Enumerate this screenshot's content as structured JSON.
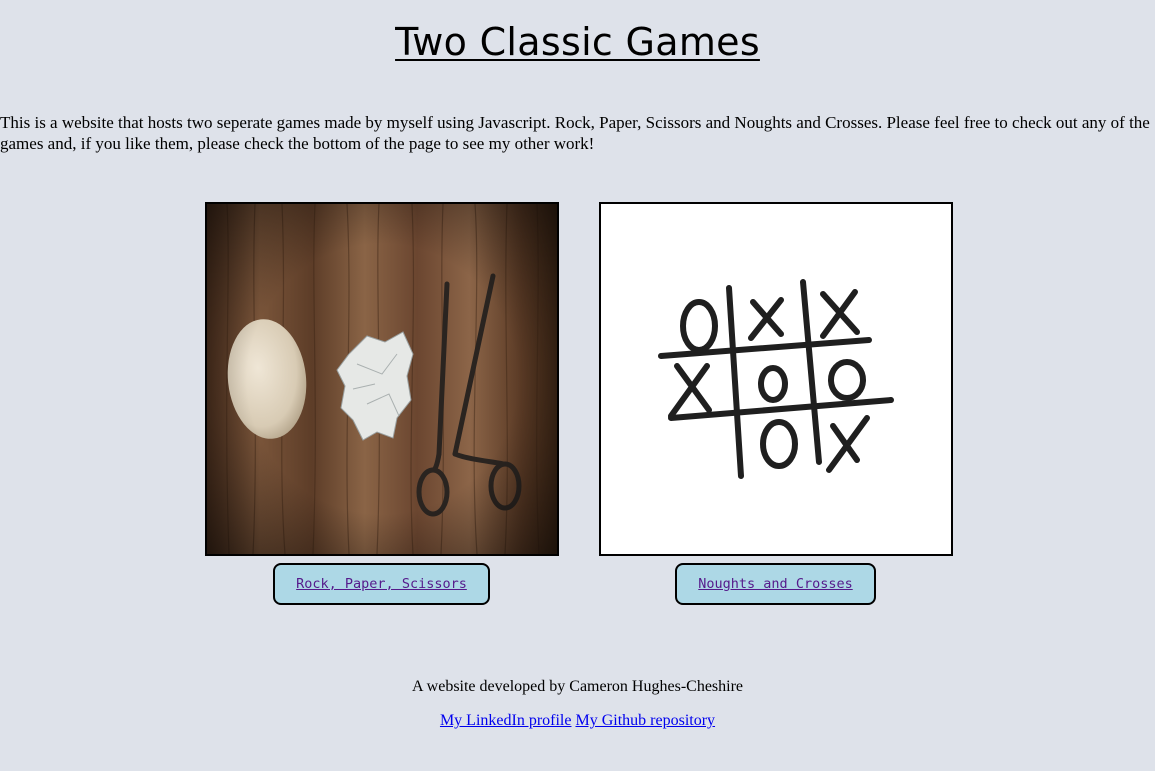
{
  "header": {
    "title": "Two Classic Games"
  },
  "intro": {
    "text": "This is a website that hosts two seperate games made by myself using Javascript. Rock, Paper, Scissors and Noughts and Crosses. Please feel free to check out any of the games and, if you like them, please check the bottom of the page to see my other work!"
  },
  "games": [
    {
      "label": "Rock, Paper, Scissors",
      "image": "rock-paper-scissors-photo"
    },
    {
      "label": "Noughts and Crosses",
      "image": "noughts-and-crosses-drawing"
    }
  ],
  "footer": {
    "credit": "A website developed by Cameron Hughes-Cheshire",
    "linkedin_label": "My LinkedIn profile",
    "github_label": "My Github repository"
  },
  "colors": {
    "background": "#dee2ea",
    "button": "#add8e6",
    "visited_link": "#551a8b",
    "link": "#0000ee"
  }
}
